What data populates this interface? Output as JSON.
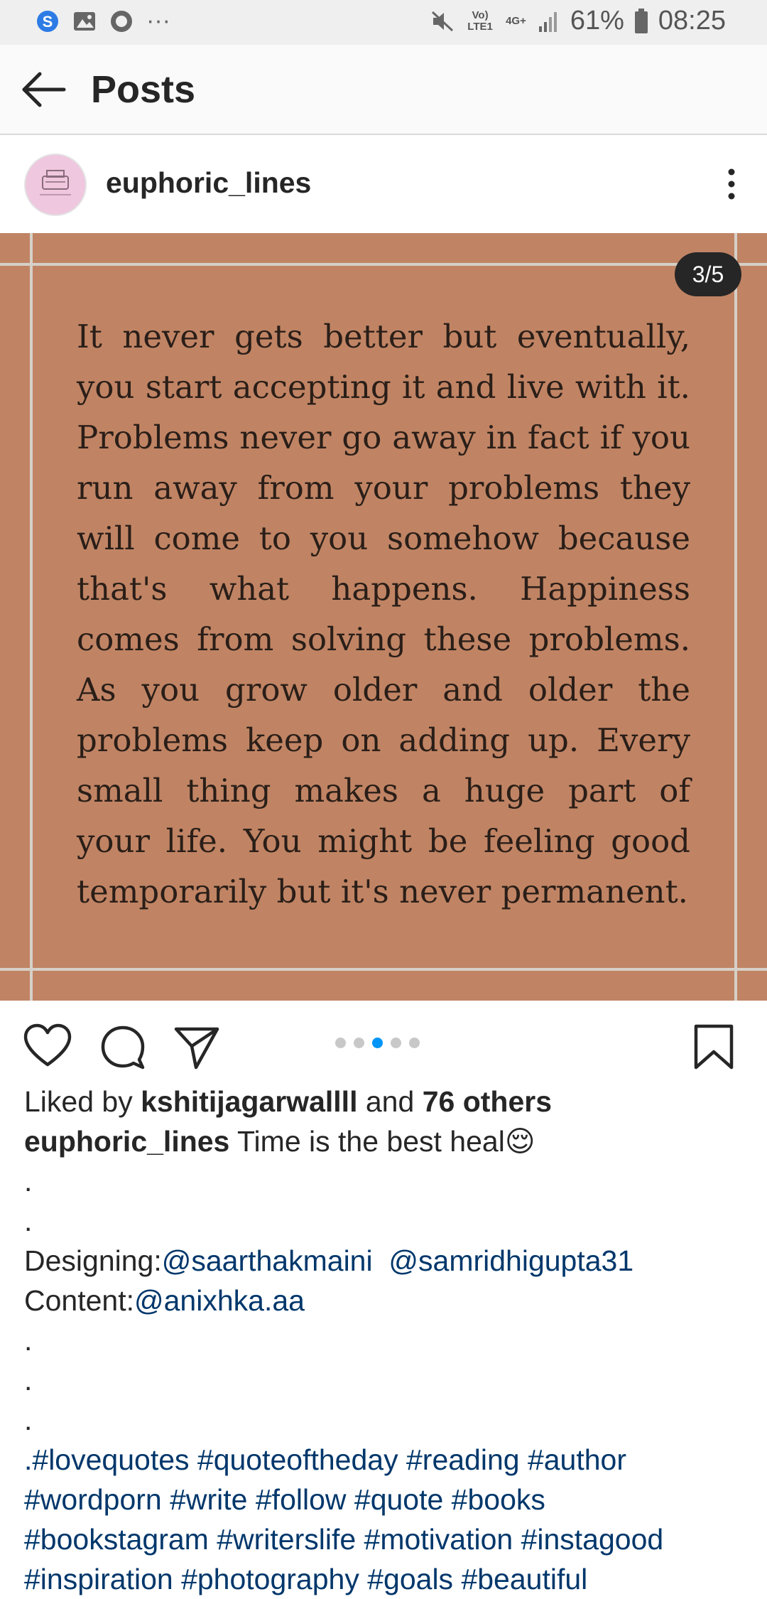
{
  "status_bar": {
    "signal_label": "Vo) LTE1",
    "net_label": "4G+",
    "battery": "61%",
    "time": "08:25",
    "more": "···"
  },
  "app_bar": {
    "title": "Posts"
  },
  "post": {
    "username": "euphoric_lines",
    "counter": "3/5",
    "quote": "It never gets better but eventually, you start accepting it and live with it. Problems never go away in fact if you run away from your problems they will come to you somehow because that's what happens. Happiness comes from solving these problems. As you grow older and older the problems keep on adding up. Every small thing makes a huge part of your life. You might be feeling good temporarily but it's never permanent.",
    "carousel_total": 5,
    "carousel_active": 3,
    "image_bg": "#c08464",
    "likes": {
      "prefix": "Liked by",
      "user": "kshitijagarwallll",
      "middle": "and",
      "others": "76 others"
    },
    "caption": {
      "user": "euphoric_lines",
      "text": "Time is the best heal",
      "emoji": "😌",
      "dot": ".",
      "designing_label": "Designing:",
      "designer_1": "@saarthakmaini",
      "designer_2": "@samridhigupta31",
      "content_label": "Content:",
      "content_writer": "@anixhka.aa",
      "hashtags_line_1": ".#lovequotes #quoteoftheday #reading #author",
      "hashtags_line_2": "#wordporn #write #follow #quote #books",
      "hashtags_line_3": "#bookstagram #writerslife #motivation #instagood",
      "hashtags_line_4": "#inspiration #photography #goals #beautiful"
    }
  },
  "colors": {
    "link": "#00376b",
    "active_dot": "#0095f6",
    "accent_text": "#262626"
  }
}
